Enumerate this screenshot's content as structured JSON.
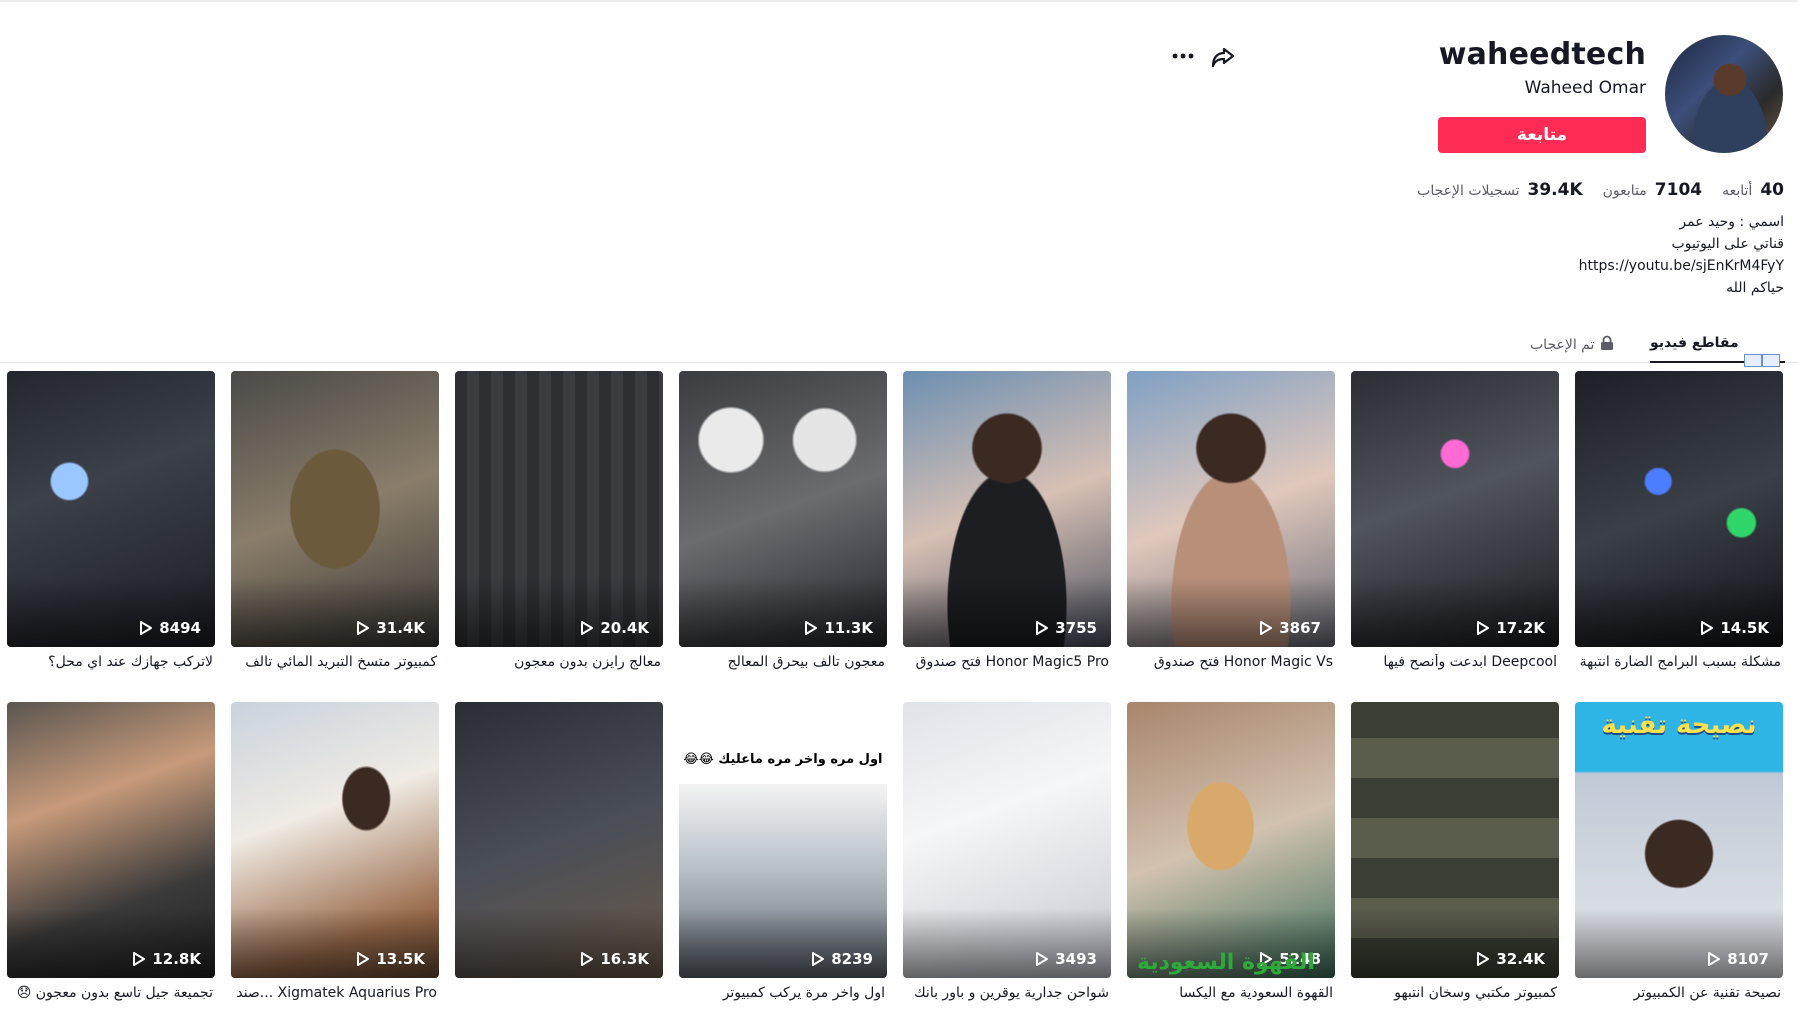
{
  "profile": {
    "username": "waheedtech",
    "nickname": "Waheed Omar",
    "follow_label": "متابعة",
    "stats": [
      {
        "num": "40",
        "label": "أتابعه"
      },
      {
        "num": "7104",
        "label": "متابعون"
      },
      {
        "num": "39.4K",
        "label": "تسجيلات الإعجاب"
      }
    ],
    "bio_lines": [
      "اسمي : وحيد عمر",
      "قناتي على اليوتيوب",
      "https://youtu.be/sjEnKrM4FyY",
      "حياكم الله"
    ]
  },
  "tabs": {
    "videos": "مقاطع فيديو",
    "liked": "تم الإعجاب"
  },
  "icons": {
    "more": "more-icon",
    "share": "share-icon",
    "lock": "lock-icon",
    "play": "play-icon"
  },
  "colors": {
    "accent": "#fe2c55",
    "text": "#161823",
    "muted": "#5b5c66"
  },
  "videos": [
    {
      "views": "14.5K",
      "caption": "مشكلة بسبب البرامج الضارة انتبهة 😡"
    },
    {
      "views": "17.2K",
      "caption": "Deepcool ابدعت وأنصح فيها"
    },
    {
      "views": "3867",
      "caption": "Honor Magic Vs فتح صندوق"
    },
    {
      "views": "3755",
      "caption": "Honor Magic5 Pro فتح صندوق"
    },
    {
      "views": "11.3K",
      "caption": "معجون تالف بيحرق المعالج"
    },
    {
      "views": "20.4K",
      "caption": "معالج رايزن بدون معجون"
    },
    {
      "views": "31.4K",
      "caption": "كمبيوتر متسخ التبريد المائي تالف"
    },
    {
      "views": "8494",
      "caption": "لاتركب جهازك عند اي محل؟"
    },
    {
      "views": "8107",
      "caption": "نصيحة تقنية عن الكمبيوتر",
      "title": "نصيحة تقنية"
    },
    {
      "views": "32.4K",
      "caption": "كمبيوتر مكتبي وسخان انتبهو"
    },
    {
      "views": "5248",
      "caption": "القهوة السعودية مع اليكسا",
      "overlay": "القهوة السعودية"
    },
    {
      "views": "3493",
      "caption": "شواحن جدارية يوقرين و باور بانك"
    },
    {
      "views": "8239",
      "caption": "اول واخر مرة يركب كمبيوتر",
      "overlay": "اول مره واخر مره ماعليك 😂😂"
    },
    {
      "views": "16.3K",
      "caption": ""
    },
    {
      "views": "13.5K",
      "caption": "Xigmatek Aquarius Pro ...صند"
    },
    {
      "views": "12.8K",
      "caption": "تجميعة جيل تاسع بدون معجون 😞"
    }
  ]
}
